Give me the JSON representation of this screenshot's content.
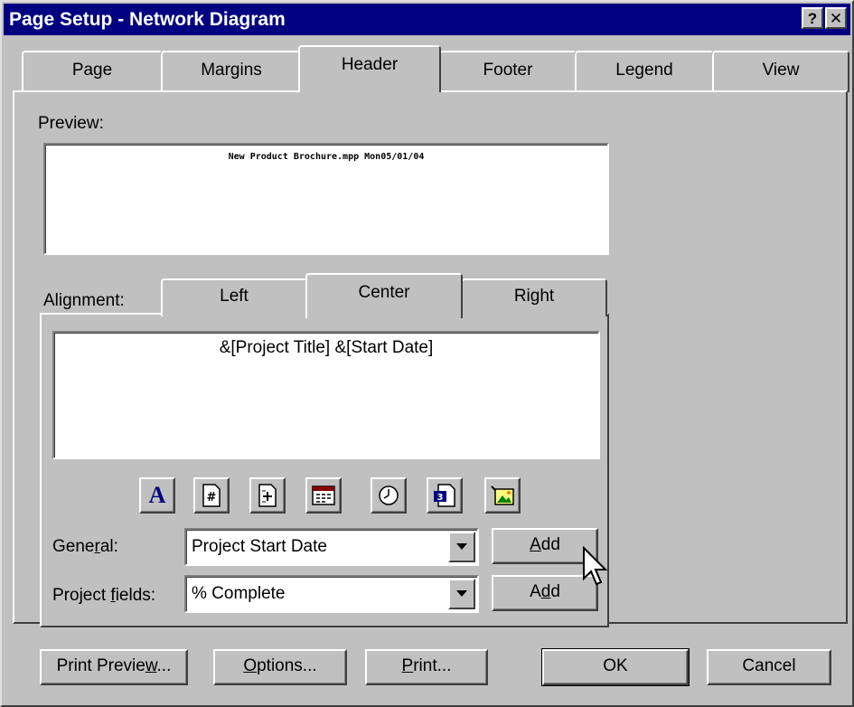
{
  "window": {
    "title": "Page Setup - Network Diagram",
    "help_glyph": "?",
    "close_glyph": "✕"
  },
  "tabs": [
    {
      "label": "Page"
    },
    {
      "label": "Margins"
    },
    {
      "label": "Header",
      "active": true
    },
    {
      "label": "Footer"
    },
    {
      "label": "Legend"
    },
    {
      "label": "View"
    }
  ],
  "preview": {
    "label": "Preview:",
    "text": "New Product Brochure.mpp Mon05/01/04"
  },
  "alignment": {
    "label": "Alignment:",
    "tabs": [
      {
        "label": "Left"
      },
      {
        "label": "Center",
        "active": true
      },
      {
        "label": "Right"
      }
    ],
    "content": "&[Project Title] &[Start Date]"
  },
  "toolbar_icons": [
    "format-text-font-icon",
    "insert-page-number-icon",
    "insert-total-pages-icon",
    "insert-current-date-icon",
    "insert-current-time-icon",
    "insert-file-name-icon",
    "insert-picture-icon"
  ],
  "fields": {
    "general": {
      "label_pre": "Gene",
      "label_accel": "r",
      "label_post": "al:",
      "value": "Project Start Date",
      "add_pre": "",
      "add_accel": "A",
      "add_post": "dd"
    },
    "project": {
      "label_pre": "Project ",
      "label_accel": "f",
      "label_post": "ields:",
      "value": "% Complete",
      "add_pre": "A",
      "add_accel": "d",
      "add_post": "d"
    }
  },
  "buttons": {
    "print_preview": {
      "pre": "Print Previe",
      "accel": "w",
      "post": "..."
    },
    "options": {
      "pre": "",
      "accel": "O",
      "post": "ptions..."
    },
    "print": {
      "pre": "",
      "accel": "P",
      "post": "rint..."
    },
    "ok": "OK",
    "cancel": "Cancel"
  }
}
